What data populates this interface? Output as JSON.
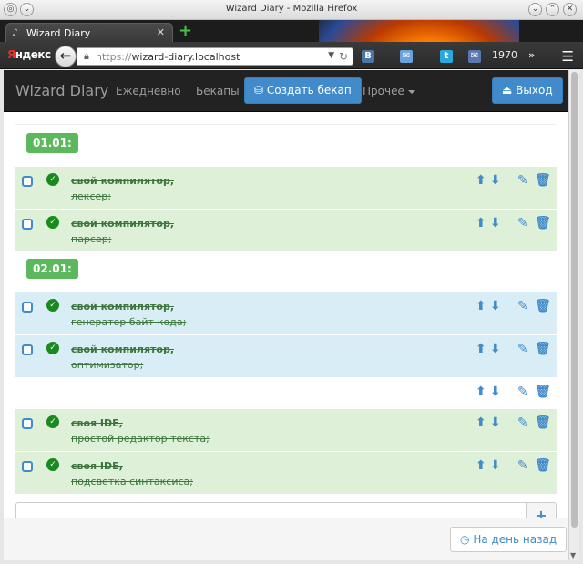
{
  "window": {
    "title": "Wizard Diary - Mozilla Firefox"
  },
  "browser": {
    "tab_label": "Wizard Diary",
    "yandex_first": "Я",
    "yandex_rest": "ндекс",
    "url_scheme": "https://",
    "url_host": "wizard-diary.localhost",
    "counter": "1970"
  },
  "app": {
    "brand": "Wizard Diary",
    "nav": [
      "Ежедневно",
      "Бекапы"
    ],
    "create_backup": "Создать бекап",
    "other": "Прочее",
    "logout": "Выход"
  },
  "groups": [
    {
      "date": "01.01:",
      "items": [
        {
          "title": "свой компилятор,",
          "desc": "лексер;",
          "style": "success"
        },
        {
          "title": "свой компилятор,",
          "desc": "парсер;",
          "style": "success"
        }
      ]
    },
    {
      "date": "02.01:",
      "items": [
        {
          "title": "свой компилятор,",
          "desc": "генератор байт-кода;",
          "style": "info"
        },
        {
          "title": "свой компилятор,",
          "desc": "оптимизатор;",
          "style": "info"
        },
        {
          "title": "",
          "desc": "",
          "style": "plain"
        },
        {
          "title": "своя IDE,",
          "desc": "простой редактор текста;",
          "style": "success"
        },
        {
          "title": "своя IDE,",
          "desc": "подсветка синтаксиса;",
          "style": "success"
        }
      ]
    }
  ],
  "add": {
    "placeholder": "",
    "button": "+"
  },
  "footer": {
    "back_day": "На день назад"
  },
  "colors": {
    "primary": "#428bca",
    "success_bg": "#dff0d8",
    "info_bg": "#d9edf7",
    "label_green": "#5cb85c"
  }
}
